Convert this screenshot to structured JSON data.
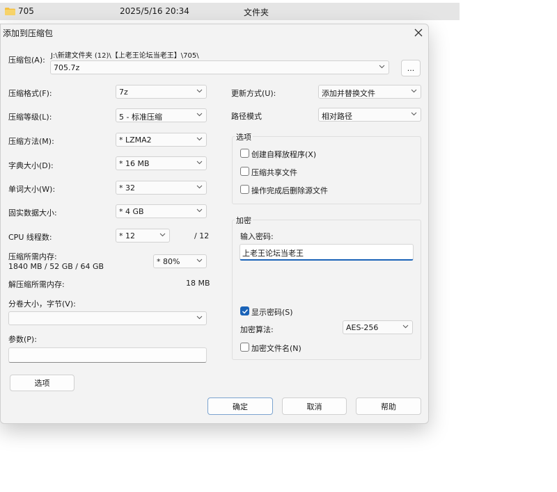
{
  "background_row": {
    "name": "705",
    "date": "2025/5/16 20:34",
    "type": "文件夹"
  },
  "dialog": {
    "title": "添加到压缩包",
    "archive_label": "压缩包(A):",
    "archive_path": "J:\\新建文件夹 (12)\\【上老王论坛当老王】\\705\\",
    "archive_name": "705.7z",
    "browse_label": "...",
    "format_label": "压缩格式(F):",
    "format_value": "7z",
    "level_label": "压缩等级(L):",
    "level_value": "5 - 标准压缩",
    "method_label": "压缩方法(M):",
    "method_value": "* LZMA2",
    "dict_label": "字典大小(D):",
    "dict_value": "* 16 MB",
    "word_label": "单词大小(W):",
    "word_value": "* 32",
    "solid_label": "固实数据大小:",
    "solid_value": "* 4 GB",
    "cpu_label": "CPU 线程数:",
    "cpu_value": "* 12",
    "cpu_total": "/ 12",
    "mem_label": "压缩所需内存:",
    "mem_value": "1840 MB / 52 GB / 64 GB",
    "mem_percent": "* 80%",
    "decomp_label": "解压缩所需内存:",
    "decomp_value": "18 MB",
    "split_label": "分卷大小，字节(V):",
    "split_value": "",
    "params_label": "参数(P):",
    "params_value": "",
    "options_button": "选项",
    "update_label": "更新方式(U):",
    "update_value": "添加并替换文件",
    "path_label": "路径模式",
    "path_value": "相对路径",
    "options_group": {
      "title": "选项",
      "sfx": "创建自释放程序(X)",
      "shared": "压缩共享文件",
      "delete": "操作完成后删除源文件"
    },
    "encrypt_group": {
      "title": "加密",
      "password_label": "输入密码:",
      "password_value": "上老王论坛当老王",
      "show_password": "显示密码(S)",
      "method_label": "加密算法:",
      "method_value": "AES-256",
      "encrypt_names": "加密文件名(N)"
    },
    "ok_button": "确定",
    "cancel_button": "取消",
    "help_button": "帮助"
  },
  "colors": {
    "accent": "#1a63b8",
    "dialog_bg": "#f3f3f3",
    "folder": "#f4c042"
  }
}
